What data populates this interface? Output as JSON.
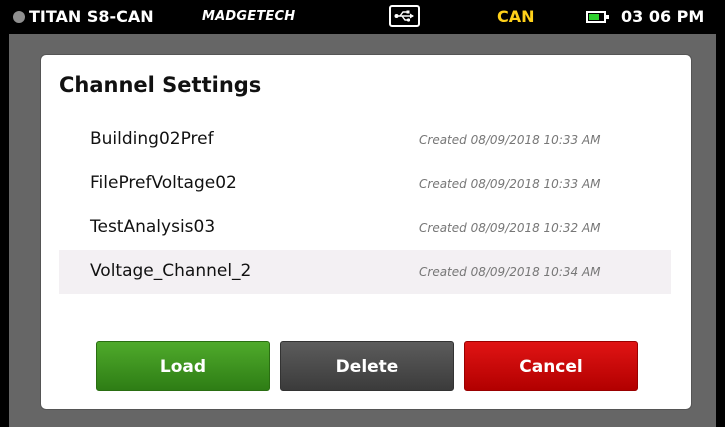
{
  "status_bar": {
    "device": "TITAN S8-CAN",
    "brand": "MADGETECH",
    "interface": "CAN",
    "time": "03 06 PM",
    "icons": [
      "status-dot-icon",
      "usb-icon",
      "battery-icon"
    ],
    "colors": {
      "interface": "#ffd11a",
      "battery": "#2fd12f"
    }
  },
  "dialog": {
    "title": "Channel Settings",
    "items": [
      {
        "name": "Building02Pref",
        "created": "Created 08/09/2018 10:33 AM",
        "selected": false
      },
      {
        "name": "FilePrefVoltage02",
        "created": "Created 08/09/2018 10:33 AM",
        "selected": false
      },
      {
        "name": "TestAnalysis03",
        "created": "Created 08/09/2018 10:32 AM",
        "selected": false
      },
      {
        "name": "Voltage_Channel_2",
        "created": "Created 08/09/2018 10:34 AM",
        "selected": true
      }
    ],
    "buttons": {
      "load": "Load",
      "delete": "Delete",
      "cancel": "Cancel"
    },
    "colors": {
      "load": "#3a9420",
      "delete": "#4a4a4a",
      "cancel": "#cc0000"
    }
  }
}
